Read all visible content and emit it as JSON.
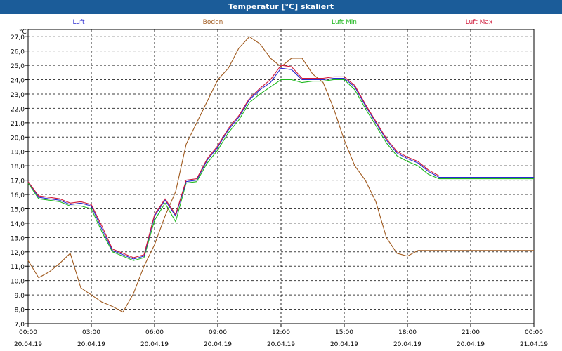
{
  "header": {
    "title": "Temperatur [°C] skaliert"
  },
  "chart_data": {
    "type": "line",
    "title": "Temperatur [°C] skaliert",
    "ylabel": "°C",
    "ylim": [
      7.0,
      27.5
    ],
    "y_ticks": [
      "7,0",
      "8,0",
      "9,0",
      "10,0",
      "11,0",
      "12,0",
      "13,0",
      "14,0",
      "15,0",
      "16,0",
      "17,0",
      "18,0",
      "19,0",
      "20,0",
      "21,0",
      "22,0",
      "23,0",
      "24,0",
      "25,0",
      "26,0",
      "27,0"
    ],
    "x_ticks": [
      {
        "time": "00:00",
        "date": "20.04.19"
      },
      {
        "time": "03:00",
        "date": "20.04.19"
      },
      {
        "time": "06:00",
        "date": "20.04.19"
      },
      {
        "time": "09:00",
        "date": "20.04.19"
      },
      {
        "time": "12:00",
        "date": "20.04.19"
      },
      {
        "time": "15:00",
        "date": "20.04.19"
      },
      {
        "time": "18:00",
        "date": "20.04.19"
      },
      {
        "time": "21:00",
        "date": "20.04.19"
      },
      {
        "time": "00:00",
        "date": "21.04.19"
      }
    ],
    "x": [
      "00:00",
      "00:30",
      "01:00",
      "01:30",
      "02:00",
      "02:30",
      "03:00",
      "03:30",
      "04:00",
      "04:30",
      "05:00",
      "05:30",
      "06:00",
      "06:30",
      "07:00",
      "07:30",
      "08:00",
      "08:30",
      "09:00",
      "09:30",
      "10:00",
      "10:30",
      "11:00",
      "11:30",
      "12:00",
      "12:30",
      "13:00",
      "13:30",
      "14:00",
      "14:30",
      "15:00",
      "15:30",
      "16:00",
      "16:30",
      "17:00",
      "17:30",
      "18:00",
      "18:30",
      "19:00",
      "19:30",
      "20:00",
      "20:30",
      "21:00",
      "21:30",
      "22:00",
      "22:30",
      "23:00",
      "23:30",
      "24:00"
    ],
    "grid": true,
    "legend_position": "top",
    "series": [
      {
        "name": "Luft",
        "color": "#2a2ad0",
        "values": [
          16.9,
          15.8,
          15.7,
          15.6,
          15.3,
          15.4,
          15.2,
          13.6,
          12.1,
          11.8,
          11.5,
          11.7,
          14.5,
          15.6,
          14.5,
          16.9,
          17.0,
          18.4,
          19.3,
          20.5,
          21.4,
          22.6,
          23.3,
          23.8,
          24.8,
          24.7,
          24.0,
          24.0,
          24.0,
          24.1,
          24.1,
          23.5,
          22.2,
          21.0,
          19.8,
          18.9,
          18.5,
          18.2,
          17.6,
          17.2,
          17.2,
          17.2,
          17.2,
          17.2,
          17.2,
          17.2,
          17.2,
          17.2,
          17.2
        ]
      },
      {
        "name": "Boden",
        "color": "#a05a1e",
        "values": [
          11.4,
          10.2,
          10.6,
          11.2,
          11.9,
          9.5,
          9.0,
          8.5,
          8.2,
          7.8,
          9.1,
          11.0,
          12.5,
          14.5,
          16.2,
          19.5,
          21.0,
          22.5,
          24.0,
          24.8,
          26.2,
          27.0,
          26.5,
          25.5,
          24.9,
          25.5,
          25.5,
          24.4,
          23.8,
          22.0,
          19.8,
          18.0,
          17.0,
          15.5,
          13.0,
          11.9,
          11.7,
          12.1,
          12.1,
          12.1,
          12.1,
          12.1,
          12.1,
          12.1,
          12.1,
          12.1,
          12.1,
          12.1,
          12.1
        ]
      },
      {
        "name": "Luft Min",
        "color": "#1fb81f",
        "values": [
          16.8,
          15.7,
          15.6,
          15.5,
          15.2,
          15.2,
          15.0,
          13.4,
          12.0,
          11.7,
          11.4,
          11.6,
          14.2,
          15.4,
          14.1,
          16.8,
          16.9,
          18.2,
          19.1,
          20.3,
          21.2,
          22.4,
          23.0,
          23.5,
          24.0,
          24.0,
          23.8,
          23.9,
          23.9,
          24.0,
          24.0,
          23.3,
          22.0,
          20.8,
          19.6,
          18.7,
          18.3,
          18.0,
          17.4,
          17.1,
          17.1,
          17.1,
          17.1,
          17.1,
          17.1,
          17.1,
          17.1,
          17.1,
          17.1
        ]
      },
      {
        "name": "Luft Max",
        "color": "#d01a3a",
        "values": [
          16.9,
          15.9,
          15.8,
          15.7,
          15.4,
          15.5,
          15.3,
          13.8,
          12.2,
          11.9,
          11.6,
          11.8,
          14.6,
          15.7,
          14.6,
          17.0,
          17.1,
          18.5,
          19.4,
          20.6,
          21.5,
          22.7,
          23.4,
          24.0,
          25.0,
          24.9,
          24.1,
          24.1,
          24.1,
          24.2,
          24.2,
          23.6,
          22.3,
          21.1,
          19.9,
          19.0,
          18.6,
          18.3,
          17.7,
          17.3,
          17.3,
          17.3,
          17.3,
          17.3,
          17.3,
          17.3,
          17.3,
          17.3,
          17.3
        ]
      }
    ]
  }
}
